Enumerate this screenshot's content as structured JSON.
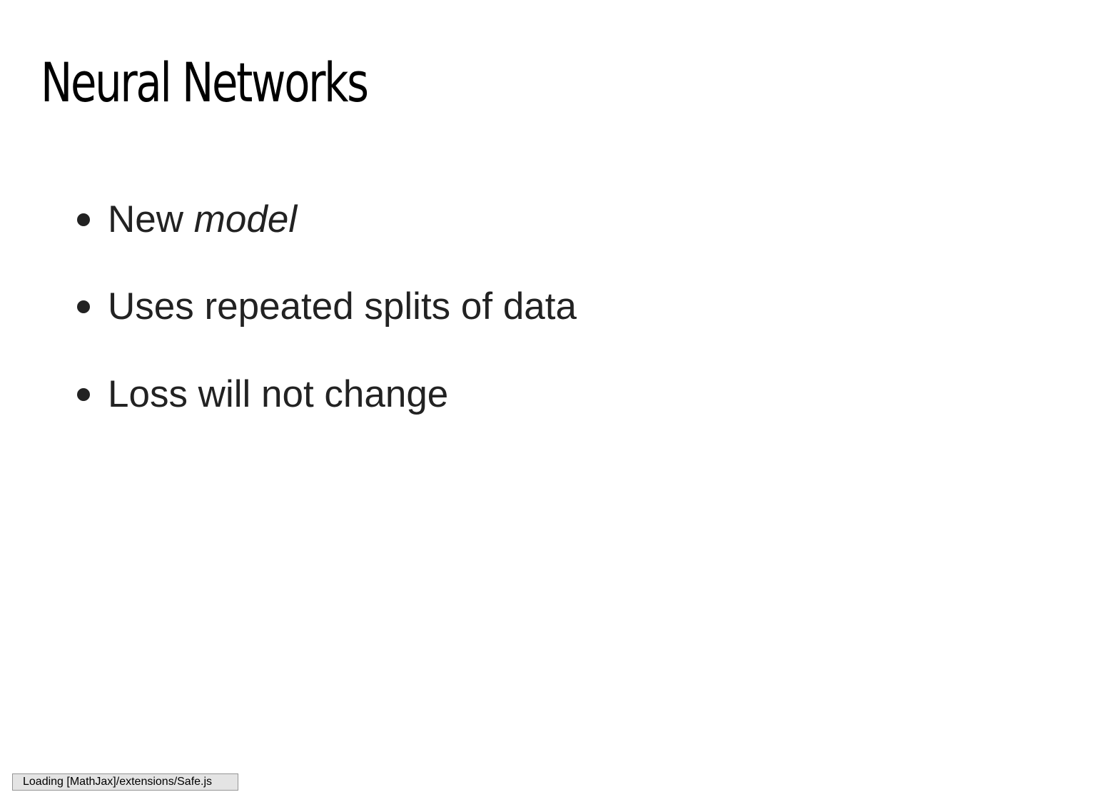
{
  "slide": {
    "title": "Neural Networks",
    "bullets": [
      {
        "text": "New ",
        "emphasis": "model"
      },
      {
        "text": "Uses repeated splits of data"
      },
      {
        "text": "Loss will not change"
      }
    ]
  },
  "status": {
    "message": "Loading [MathJax]/extensions/Safe.js"
  },
  "colors": {
    "title": "#000000",
    "body_text": "#222222",
    "background": "#ffffff",
    "status_bg": "#e4e4e4",
    "status_border": "#959595"
  }
}
